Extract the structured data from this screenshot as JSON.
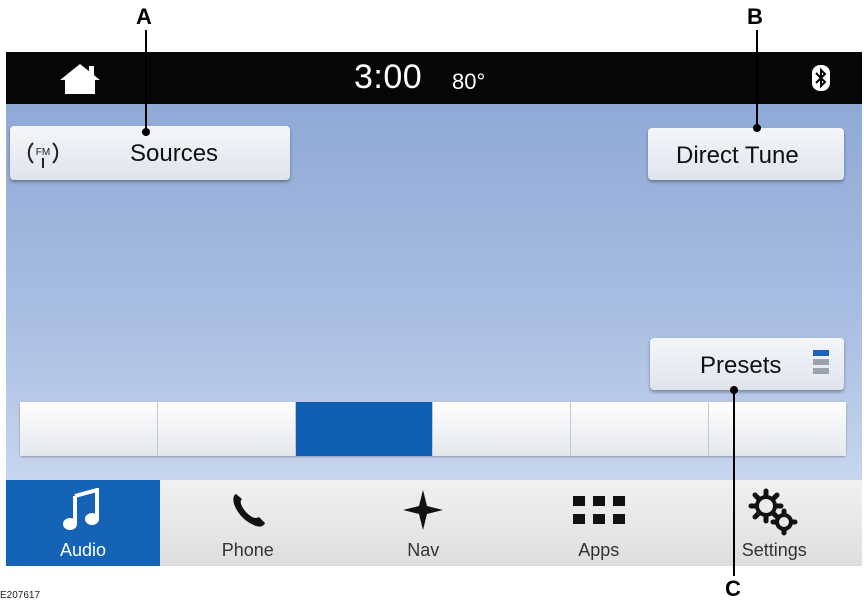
{
  "callouts": {
    "a": "A",
    "b": "B",
    "c": "C"
  },
  "figure_code": "E207617",
  "status_bar": {
    "time": "3:00",
    "temperature": "80°"
  },
  "sources_button": {
    "label": "Sources",
    "icon_text": "FM"
  },
  "direct_tune_button": {
    "label": "Direct Tune"
  },
  "presets_button": {
    "label": "Presets"
  },
  "tuner_segments": 6,
  "tuner_active_segment": 3,
  "nav": [
    {
      "label": "Audio",
      "icon": "music-note-icon",
      "active": true
    },
    {
      "label": "Phone",
      "icon": "phone-icon",
      "active": false
    },
    {
      "label": "Nav",
      "icon": "compass-star-icon",
      "active": false
    },
    {
      "label": "Apps",
      "icon": "apps-grid-icon",
      "active": false
    },
    {
      "label": "Settings",
      "icon": "gears-icon",
      "active": false
    }
  ],
  "colors": {
    "active_blue": "#1463b6",
    "tuner_active": "#0e5fb3",
    "preset_indicator_on": "#1a63c2",
    "preset_indicator_off": "#9aa3ad"
  }
}
